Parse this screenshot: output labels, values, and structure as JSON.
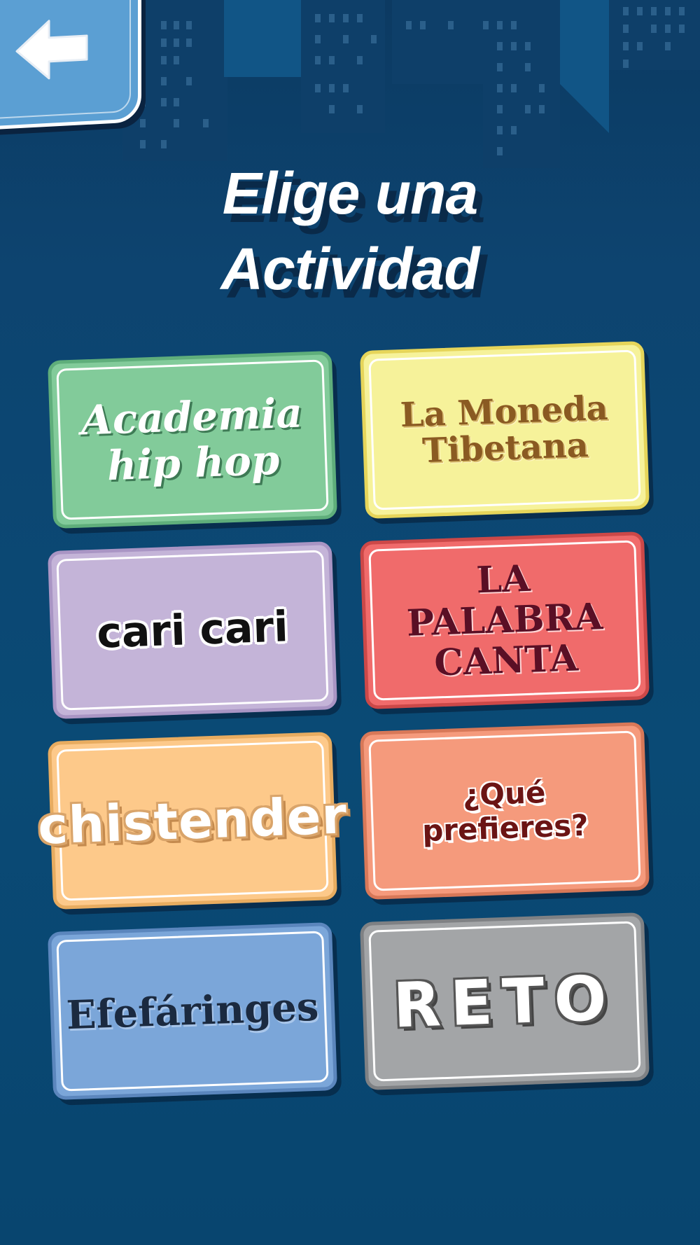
{
  "header": {
    "back_icon": "arrow-left-icon",
    "title_line1": "Elige una",
    "title_line2": "Actividad"
  },
  "activities": [
    {
      "label_line1": "Academia",
      "label_line2": "hip hop",
      "color": "#82cb9a"
    },
    {
      "label_line1": "La Moneda",
      "label_line2": "Tibetana",
      "color": "#f6f29a"
    },
    {
      "label_line1": "cari cari",
      "label_line2": "",
      "color": "#c4b4d8"
    },
    {
      "label_line1": "LA PALABRA",
      "label_line2": "CANTA",
      "color": "#f06b6b"
    },
    {
      "label_line1": "chistender",
      "label_line2": "",
      "color": "#fdc98a"
    },
    {
      "label_line1": "¿Qué prefieres?",
      "label_line2": "",
      "color": "#f59a7c"
    },
    {
      "label_line1": "Efefáringes",
      "label_line2": "",
      "color": "#7ba6d9"
    },
    {
      "label_line1": "RETO",
      "label_line2": "",
      "color": "#a3a5a7"
    }
  ],
  "colors": {
    "background": "#0d4470",
    "title_text": "#ffffff",
    "back_button": "#5b9fd3"
  }
}
